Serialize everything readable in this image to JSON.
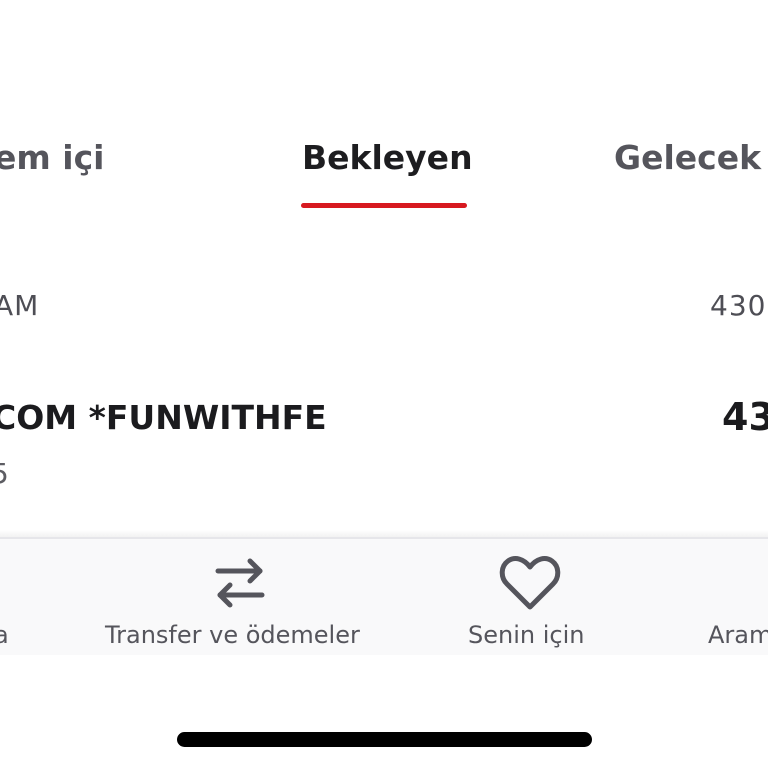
{
  "colors": {
    "accent": "#d71920",
    "text_primary": "#1b1b1e",
    "text_secondary": "#55555c",
    "nav_background": "#f9f9fa"
  },
  "tabs": [
    {
      "label": "em içi",
      "active": false
    },
    {
      "label": "Bekleyen",
      "active": true
    },
    {
      "label": "Gelecek",
      "active": false
    }
  ],
  "section": {
    "label": "AM",
    "amount": "430"
  },
  "transaction": {
    "merchant": "COM *FUNWITHFE",
    "date": "5",
    "amount": "43"
  },
  "bottom_nav": [
    {
      "label": "a",
      "icon": "cut-off-icon"
    },
    {
      "label": "Transfer ve ödemeler",
      "icon": "transfer-arrows-icon"
    },
    {
      "label": "Senin için",
      "icon": "heart-icon"
    },
    {
      "label": "Aram",
      "icon": "cut-off-icon"
    }
  ]
}
